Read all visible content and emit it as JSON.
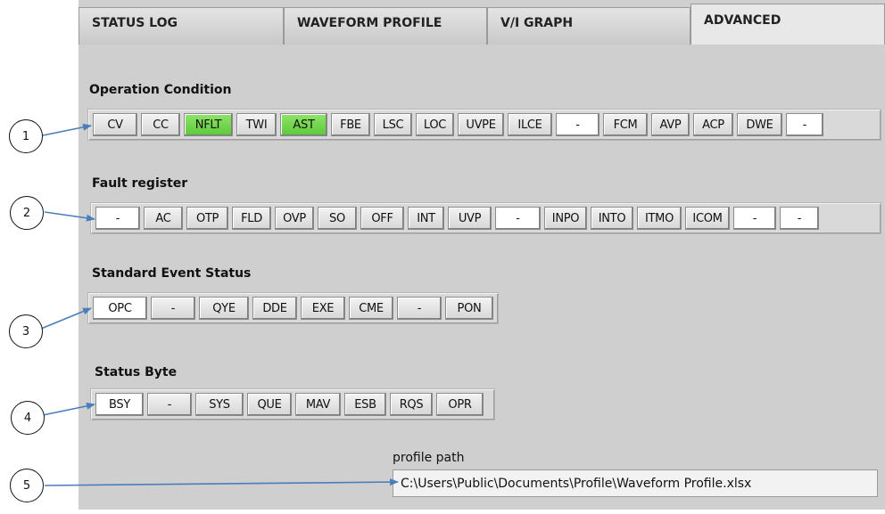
{
  "tabs": [
    {
      "label": "STATUS LOG"
    },
    {
      "label": "WAVEFORM PROFILE"
    },
    {
      "label": "V/I GRAPH"
    },
    {
      "label": "ADVANCED"
    }
  ],
  "sections": {
    "operation_condition": {
      "title": "Operation Condition",
      "indicators": [
        {
          "label": "CV",
          "state": "off"
        },
        {
          "label": "CC",
          "state": "off"
        },
        {
          "label": "NFLT",
          "state": "on"
        },
        {
          "label": "TWI",
          "state": "off"
        },
        {
          "label": "AST",
          "state": "on"
        },
        {
          "label": "FBE",
          "state": "off"
        },
        {
          "label": "LSC",
          "state": "off"
        },
        {
          "label": "LOC",
          "state": "off"
        },
        {
          "label": "UVPE",
          "state": "off"
        },
        {
          "label": "ILCE",
          "state": "off"
        },
        {
          "label": "-",
          "state": "white"
        },
        {
          "label": "FCM",
          "state": "off"
        },
        {
          "label": "AVP",
          "state": "off"
        },
        {
          "label": "ACP",
          "state": "off"
        },
        {
          "label": "DWE",
          "state": "off"
        },
        {
          "label": "-",
          "state": "white"
        }
      ]
    },
    "fault_register": {
      "title": "Fault register",
      "indicators": [
        {
          "label": "-",
          "state": "white"
        },
        {
          "label": "AC",
          "state": "off"
        },
        {
          "label": "OTP",
          "state": "off"
        },
        {
          "label": "FLD",
          "state": "off"
        },
        {
          "label": "OVP",
          "state": "off"
        },
        {
          "label": "SO",
          "state": "off"
        },
        {
          "label": "OFF",
          "state": "off"
        },
        {
          "label": "INT",
          "state": "off"
        },
        {
          "label": "UVP",
          "state": "off"
        },
        {
          "label": "-",
          "state": "white"
        },
        {
          "label": "INPO",
          "state": "off"
        },
        {
          "label": "INTO",
          "state": "off"
        },
        {
          "label": "ITMO",
          "state": "off"
        },
        {
          "label": "ICOM",
          "state": "off"
        },
        {
          "label": "-",
          "state": "white"
        },
        {
          "label": "-",
          "state": "white"
        }
      ]
    },
    "standard_event_status": {
      "title": "Standard Event Status",
      "indicators": [
        {
          "label": "OPC",
          "state": "white"
        },
        {
          "label": "-",
          "state": "off"
        },
        {
          "label": "QYE",
          "state": "off"
        },
        {
          "label": "DDE",
          "state": "off"
        },
        {
          "label": "EXE",
          "state": "off"
        },
        {
          "label": "CME",
          "state": "off"
        },
        {
          "label": "-",
          "state": "off"
        },
        {
          "label": "PON",
          "state": "off"
        }
      ]
    },
    "status_byte": {
      "title": "Status Byte",
      "indicators": [
        {
          "label": "BSY",
          "state": "white"
        },
        {
          "label": "-",
          "state": "off"
        },
        {
          "label": "SYS",
          "state": "off"
        },
        {
          "label": "QUE",
          "state": "off"
        },
        {
          "label": "MAV",
          "state": "off"
        },
        {
          "label": "ESB",
          "state": "off"
        },
        {
          "label": "RQS",
          "state": "off"
        },
        {
          "label": "OPR",
          "state": "off"
        }
      ]
    }
  },
  "profile_path": {
    "label": "profile path",
    "value": "C:\\Users\\Public\\Documents\\Profile\\Waveform Profile.xlsx"
  },
  "callouts": [
    "1",
    "2",
    "3",
    "4",
    "5"
  ],
  "colors": {
    "indicator_on": "#5cc93a",
    "panel_bg": "#cfcfcf",
    "arrow": "#4a7ebb"
  }
}
